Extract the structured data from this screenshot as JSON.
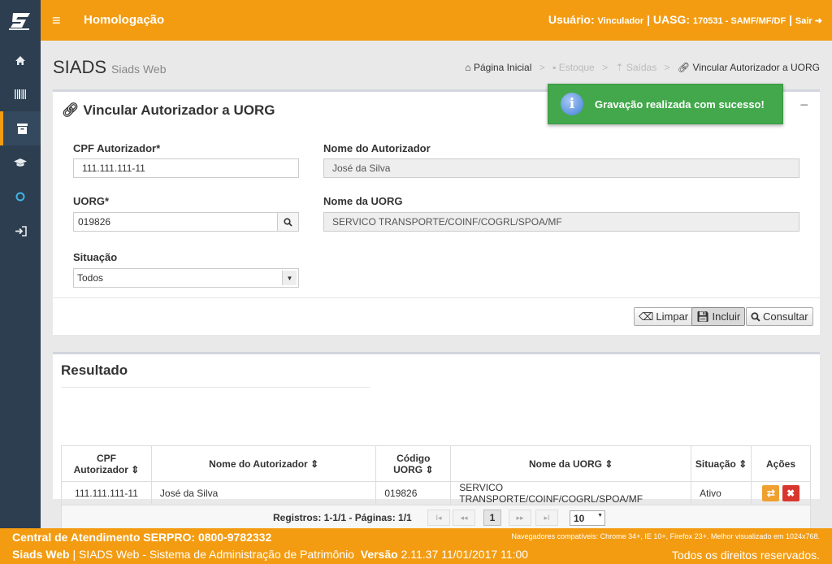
{
  "header": {
    "title": "Homologação",
    "user_label": "Usuário:",
    "user_name": "Vinculador",
    "sep1": "|",
    "uasg_label": "UASG:",
    "uasg_value": "170531 - SAMF/MF/DF",
    "sep2": "|",
    "logout": "Sair"
  },
  "sidebar": {
    "items": [
      {
        "icon": "home-icon"
      },
      {
        "icon": "barcode-icon"
      },
      {
        "icon": "archive-icon"
      },
      {
        "icon": "graduation-cap-icon"
      },
      {
        "icon": "circle-icon"
      },
      {
        "icon": "sign-in-icon"
      }
    ]
  },
  "page": {
    "title": "SIADS",
    "subtitle": "Siads Web"
  },
  "breadcrumb": {
    "home": "Página Inicial",
    "estoque": "Estoque",
    "saidas": "Saídas",
    "current": "Vincular Autorizador a UORG",
    "sep": ">"
  },
  "form": {
    "title": "Vincular Autorizador a UORG",
    "collapse": "−",
    "cpf_label": "CPF Autorizador*",
    "cpf_value": "111.111.111-11",
    "nome_label": "Nome do Autorizador",
    "nome_value": "José da Silva",
    "uorg_label": "UORG*",
    "uorg_value": "019826",
    "nome_uorg_label": "Nome da UORG",
    "nome_uorg_value": "SERVICO TRANSPORTE/COINF/COGRL/SPOA/MF",
    "situacao_label": "Situação",
    "situacao_value": "Todos",
    "limpar": "Limpar",
    "incluir": "Incluir",
    "consultar": "Consultar"
  },
  "result": {
    "title": "Resultado",
    "headers": [
      "CPF Autorizador",
      "Nome do Autorizador",
      "Código UORG",
      "Nome da UORG",
      "Situação",
      "Ações"
    ],
    "header_lines": {
      "cpf_1": "CPF",
      "cpf_2": "Autorizador",
      "cod_1": "Código",
      "cod_2": "UORG"
    },
    "rows": [
      {
        "cpf": "111.111.111-11",
        "nome": "José da Silva",
        "codigo": "019826",
        "uorg": "SERVICO TRANSPORTE/COINF/COGRL/SPOA/MF",
        "situacao": "Ativo"
      }
    ],
    "pager_info": "Registros: 1-1/1 - Páginas: 1/1",
    "current_page": "1",
    "page_size": "10",
    "pager_glyphs": {
      "first": "I◂",
      "prev": "◂◂",
      "next": "▸▸",
      "last": "▸I"
    }
  },
  "toast": {
    "message": "Gravação realizada com sucesso!",
    "icon": "i"
  },
  "footer": {
    "central": "Central de Atendimento SERPRO: 0800-9782332",
    "browsers": "Navegadores compatíveis: Chrome 34+, IE 10+, Firefox 23+. Melhor visualizado em 1024x768.",
    "app": "Siads Web",
    "app_rest": "| SIADS Web - Sistema de Administração de Patrimônio",
    "version_label": "Versão",
    "version": "2.11.37 11/01/2017 11:00",
    "rights": "Todos os direitos reservados."
  },
  "colors": {
    "accent": "#f39c12",
    "sidebar": "#2c3e50",
    "success": "#42a84b",
    "danger": "#d9372e"
  }
}
